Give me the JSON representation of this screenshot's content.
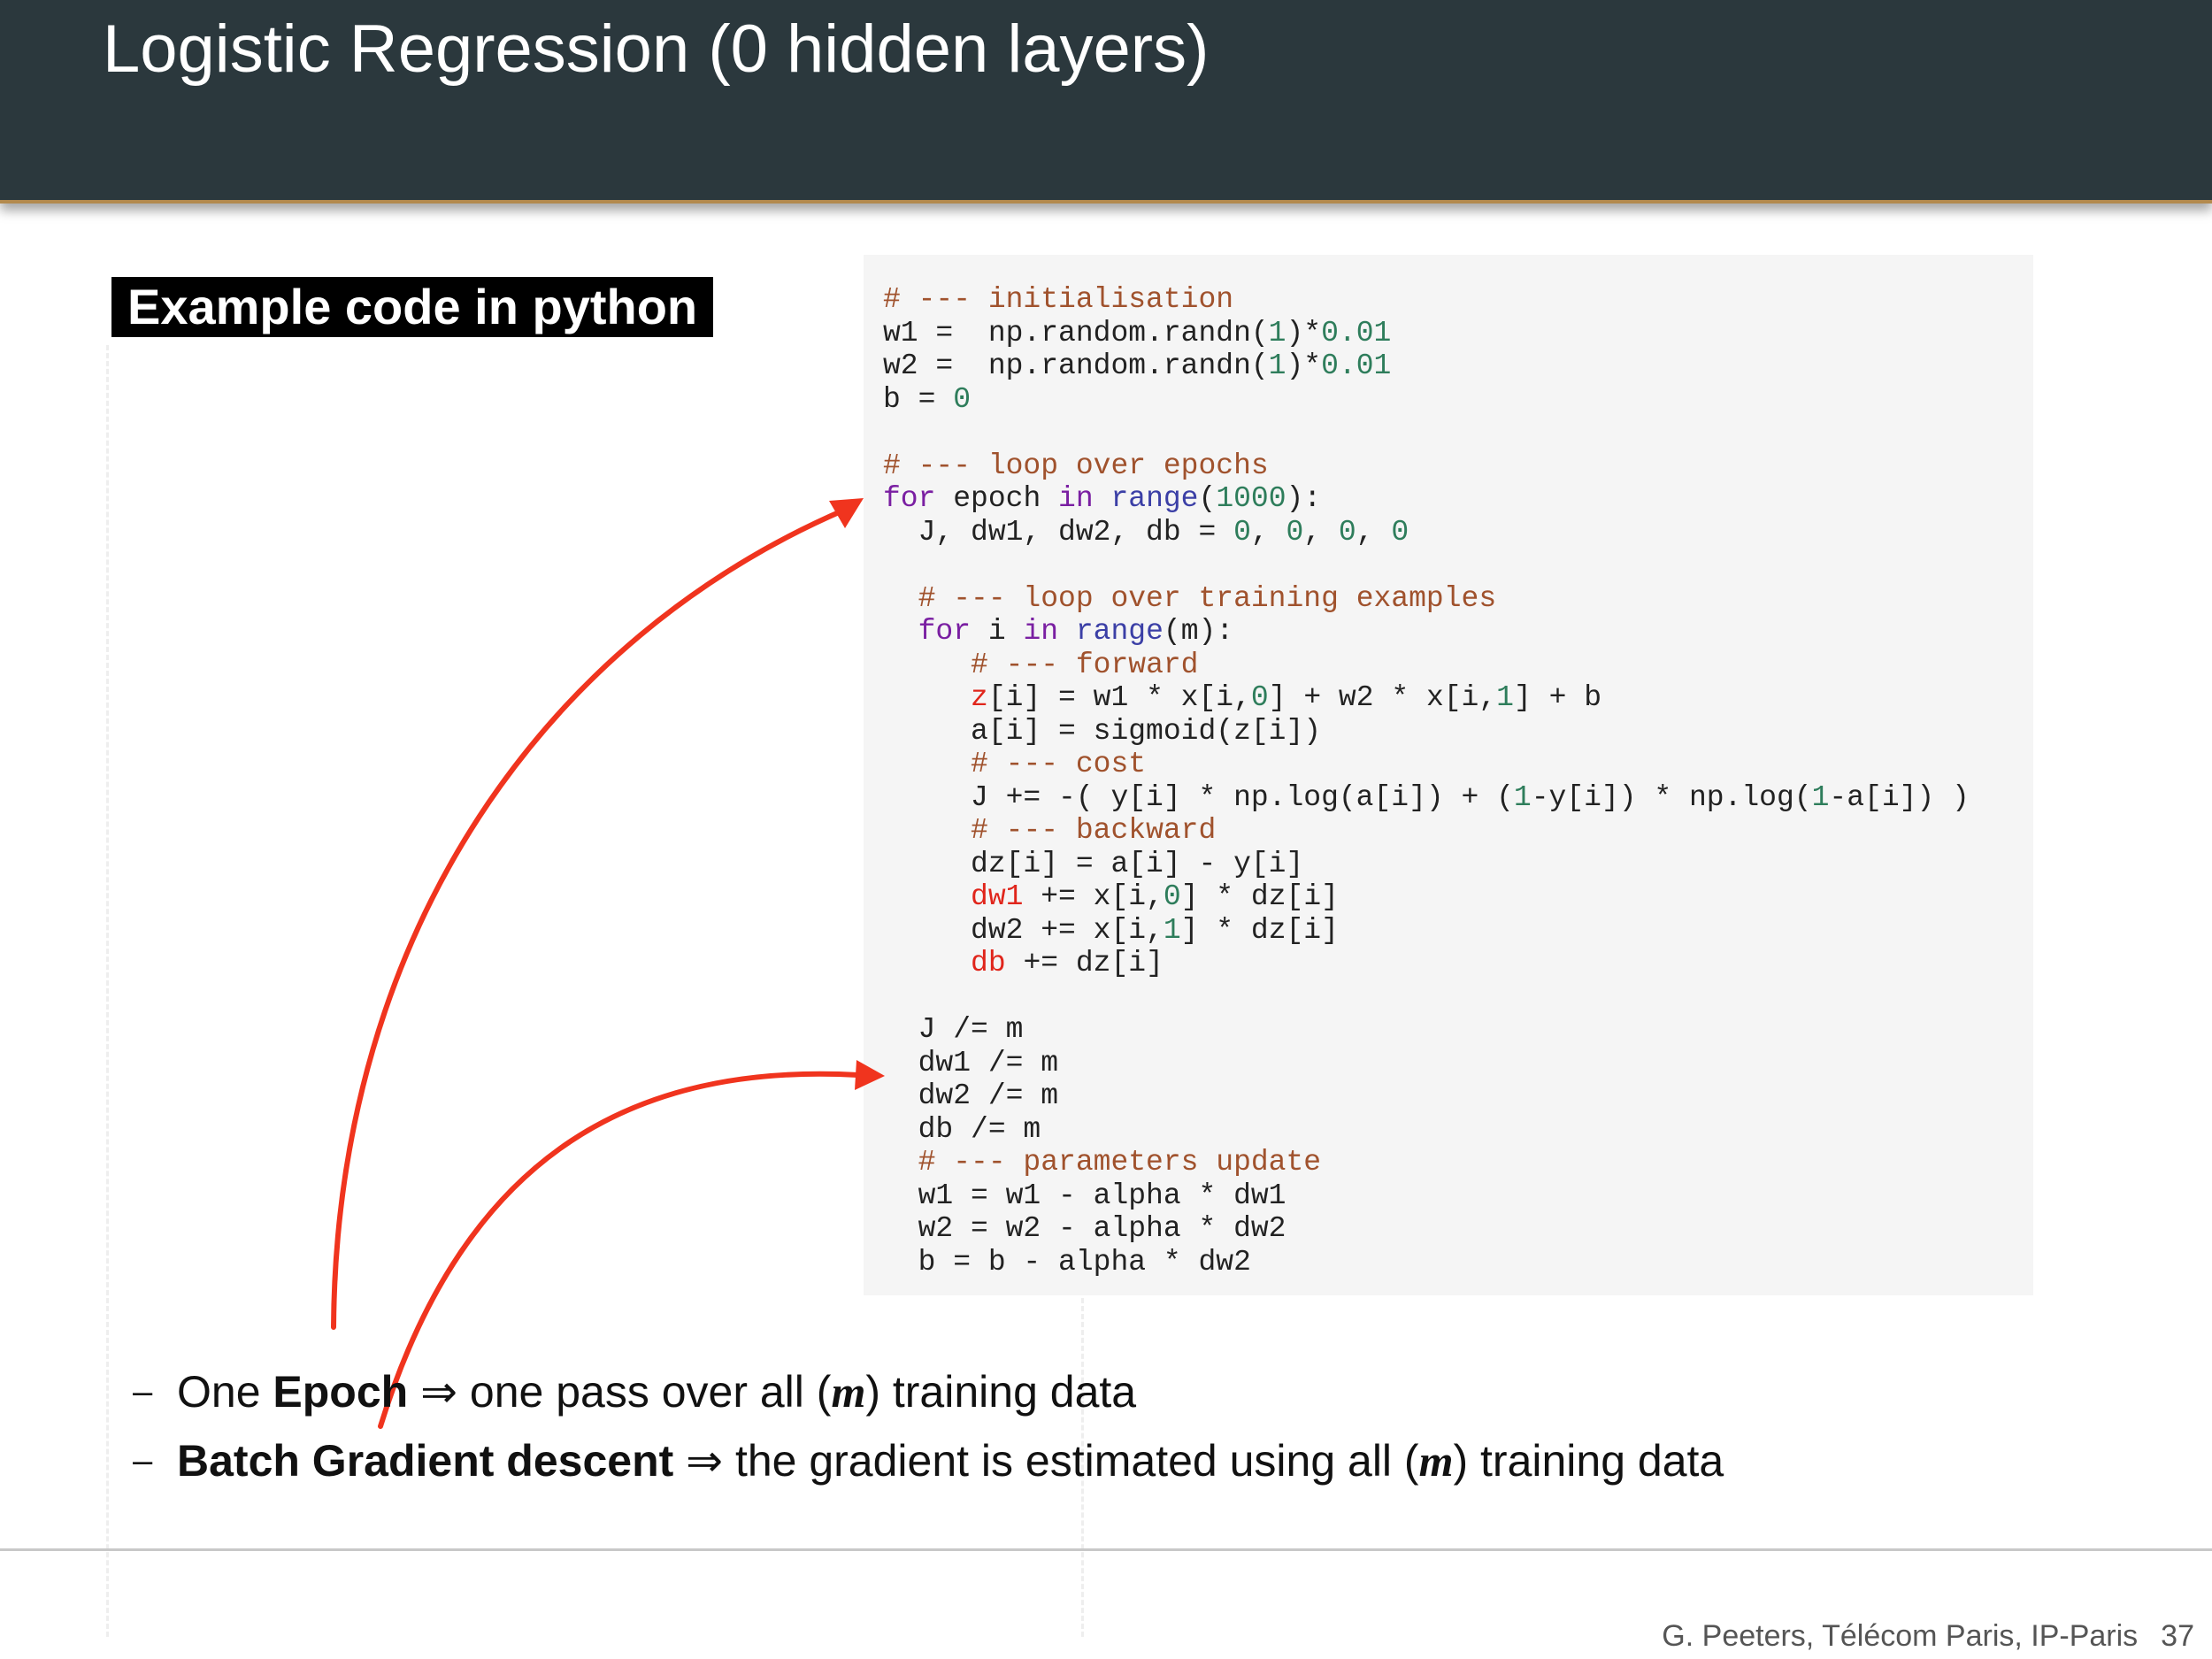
{
  "slide": {
    "title": "Logistic Regression (0 hidden layers)",
    "section_label": "Example code in python"
  },
  "code_lines": [
    [
      {
        "t": "# --- initialisation",
        "c": "cm"
      }
    ],
    [
      {
        "t": "w1 =  np.random.randn("
      },
      {
        "t": "1",
        "c": "nm"
      },
      {
        "t": ")*"
      },
      {
        "t": "0.01",
        "c": "nm"
      }
    ],
    [
      {
        "t": "w2 =  np.random.randn("
      },
      {
        "t": "1",
        "c": "nm"
      },
      {
        "t": ")*"
      },
      {
        "t": "0.01",
        "c": "nm"
      }
    ],
    [
      {
        "t": "b = "
      },
      {
        "t": "0",
        "c": "nm"
      }
    ],
    [],
    [
      {
        "t": "# --- loop over epochs",
        "c": "cm"
      }
    ],
    [
      {
        "t": "for",
        "c": "kw"
      },
      {
        "t": " epoch "
      },
      {
        "t": "in",
        "c": "kw"
      },
      {
        "t": " "
      },
      {
        "t": "range",
        "c": "bi"
      },
      {
        "t": "("
      },
      {
        "t": "1000",
        "c": "nm"
      },
      {
        "t": "):"
      }
    ],
    [
      {
        "t": "  J, dw1, dw2, db = "
      },
      {
        "t": "0",
        "c": "nm"
      },
      {
        "t": ", "
      },
      {
        "t": "0",
        "c": "nm"
      },
      {
        "t": ", "
      },
      {
        "t": "0",
        "c": "nm"
      },
      {
        "t": ", "
      },
      {
        "t": "0",
        "c": "nm"
      }
    ],
    [],
    [
      {
        "t": "  "
      },
      {
        "t": "# --- loop over training examples",
        "c": "cm"
      }
    ],
    [
      {
        "t": "  "
      },
      {
        "t": "for",
        "c": "kw"
      },
      {
        "t": " i "
      },
      {
        "t": "in",
        "c": "kw"
      },
      {
        "t": " "
      },
      {
        "t": "range",
        "c": "bi"
      },
      {
        "t": "(m):"
      }
    ],
    [
      {
        "t": "     "
      },
      {
        "t": "# --- forward",
        "c": "cm"
      }
    ],
    [
      {
        "t": "     "
      },
      {
        "t": "z",
        "c": "hl"
      },
      {
        "t": "[i] = w1 * x[i,"
      },
      {
        "t": "0",
        "c": "nm"
      },
      {
        "t": "] + w2 * x[i,"
      },
      {
        "t": "1",
        "c": "nm"
      },
      {
        "t": "] + b"
      }
    ],
    [
      {
        "t": "     a[i] = sigmoid(z[i])"
      }
    ],
    [
      {
        "t": "     "
      },
      {
        "t": "# --- cost",
        "c": "cm"
      }
    ],
    [
      {
        "t": "     J += -( y[i] * np.log(a[i]) + ("
      },
      {
        "t": "1",
        "c": "nm"
      },
      {
        "t": "-y[i]) * np.log("
      },
      {
        "t": "1",
        "c": "nm"
      },
      {
        "t": "-a[i]) )"
      }
    ],
    [
      {
        "t": "     "
      },
      {
        "t": "# --- backward",
        "c": "cm"
      }
    ],
    [
      {
        "t": "     dz[i] = a[i] - y[i]"
      }
    ],
    [
      {
        "t": "     "
      },
      {
        "t": "dw1",
        "c": "hl"
      },
      {
        "t": " += x[i,"
      },
      {
        "t": "0",
        "c": "nm"
      },
      {
        "t": "] * dz[i]"
      }
    ],
    [
      {
        "t": "     dw2 += x[i,"
      },
      {
        "t": "1",
        "c": "nm"
      },
      {
        "t": "] * dz[i]"
      }
    ],
    [
      {
        "t": "     "
      },
      {
        "t": "db",
        "c": "hl"
      },
      {
        "t": " += dz[i]"
      }
    ],
    [],
    [
      {
        "t": "  J /= m"
      }
    ],
    [
      {
        "t": "  dw1 /= m"
      }
    ],
    [
      {
        "t": "  dw2 /= m"
      }
    ],
    [
      {
        "t": "  db /= m"
      }
    ],
    [
      {
        "t": "  "
      },
      {
        "t": "# --- parameters update",
        "c": "cm"
      }
    ],
    [
      {
        "t": "  w1 = w1 - alpha * dw1"
      }
    ],
    [
      {
        "t": "  w2 = w2 - alpha * dw2"
      }
    ],
    [
      {
        "t": "  b = b - alpha * dw2"
      }
    ]
  ],
  "bullets": [
    {
      "dash": "–",
      "pre": "One ",
      "bold": "Epoch",
      "arrow": " ⇒ ",
      "post1": "one pass over all (",
      "var": "m",
      "post2": ") training data"
    },
    {
      "dash": "–",
      "pre": "",
      "bold": "Batch Gradient descent",
      "arrow": " ⇒ ",
      "post1": "the gradient is estimated using all (",
      "var": "m",
      "post2": ") training data"
    }
  ],
  "footer": {
    "author": "G. Peeters, Télécom Paris, IP-Paris",
    "page": "37"
  },
  "colors": {
    "header_bg": "#2b383d",
    "header_rule": "#b38a4e",
    "code_comment": "#a0522d",
    "code_keyword": "#7a1fa2",
    "code_builtin": "#3b3fa6",
    "code_number": "#2e7d5b",
    "code_highlight": "#e0251b",
    "annotation_arrow": "#f0341e"
  }
}
